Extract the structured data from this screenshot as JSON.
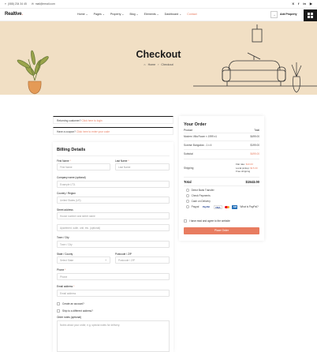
{
  "topbar": {
    "phone": "(088) 234 34 45",
    "email": "mail@email.com",
    "social": [
      "X",
      "f",
      "in",
      "▶"
    ]
  },
  "nav": {
    "logo": "Realtive",
    "menu": [
      "Home",
      "Pages",
      "Property",
      "Blog",
      "Elements",
      "Dashboard",
      "Contact"
    ],
    "add_property": "Add Property"
  },
  "hero": {
    "title": "Checkout",
    "breadcrumb_home": "Home",
    "breadcrumb_sep": "›",
    "breadcrumb_current": "Checkout"
  },
  "notices": {
    "returning_text": "Returning customer?",
    "returning_link": "Click here to login",
    "coupon_text": "Have a coupon?",
    "coupon_link": "Click here to enter your code"
  },
  "billing": {
    "title": "Billing Details",
    "first_name_label": "First Name",
    "first_name_ph": "First Name",
    "last_name_label": "Last Name",
    "last_name_ph": "Last Name",
    "company_label": "Company name (optional)",
    "company_ph": "Example LTD.",
    "country_label": "Country / Region",
    "country_value": "United States (US)",
    "street_label": "Street address",
    "street_ph": "House number and street name",
    "street2_ph": "Apartment, suite, unit, etc. (optional)",
    "town_label": "Town / City",
    "town_ph": "Town / City",
    "state_label": "State / County",
    "state_value": "Select State",
    "postcode_label": "Postcode / ZIP",
    "postcode_ph": "Postcode / ZIP",
    "phone_label": "Phone",
    "phone_ph": "Phone",
    "email_label": "Email address",
    "email_ph": "Email address",
    "create_account": "Create an account?",
    "ship_different": "Ship to a different address?",
    "notes_label": "Order notes (optional)",
    "notes_ph": "Notes about your order, e.g. special notes for delivery."
  },
  "order": {
    "title": "Your Order",
    "col_product": "Product",
    "col_total": "Total",
    "items": [
      {
        "name": "Modern Villa Room × 1999 x1",
        "total": "$499.00"
      },
      {
        "name": "Sunrise Bungalow - 1 x 4",
        "total": "$199.00"
      }
    ],
    "subtotal_label": "Subtotal",
    "subtotal_value": "$499.00",
    "shipping_label": "Shipping",
    "shipping_options": [
      {
        "label": "Flat rate:",
        "price": "$10.00"
      },
      {
        "label": "Local pickup:",
        "price": "$15.00"
      },
      {
        "label": "Free shipping",
        "price": ""
      }
    ],
    "total_label": "Total",
    "total_value": "$1543.00",
    "payments": [
      "Direct Bank Transfer",
      "Check Payments",
      "Cash on Delivery",
      "Paypal"
    ],
    "what_is_paypal": "What is PayPal?",
    "terms": "I have read and agree to the website",
    "place_order": "Place Order",
    "colors": {
      "accent": "#e87c60",
      "hero_bg": "#f1dfc4"
    }
  }
}
